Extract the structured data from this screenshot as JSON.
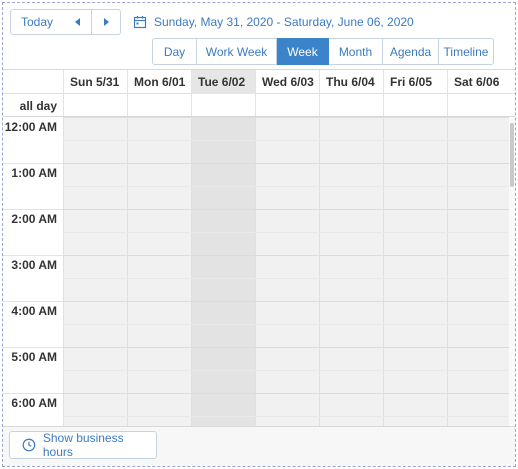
{
  "toolbar": {
    "today_label": "Today",
    "prev_icon": "chevron-left-icon",
    "next_icon": "chevron-right-icon",
    "date_range": "Sunday, May 31, 2020 - Saturday, June 06, 2020",
    "calendar_icon": "calendar-icon"
  },
  "views": [
    {
      "label": "Day",
      "active": false
    },
    {
      "label": "Work Week",
      "active": false
    },
    {
      "label": "Week",
      "active": true
    },
    {
      "label": "Month",
      "active": false
    },
    {
      "label": "Agenda",
      "active": false
    },
    {
      "label": "Timeline",
      "active": false
    }
  ],
  "days": [
    {
      "label": "Sun 5/31",
      "today": false
    },
    {
      "label": "Mon 6/01",
      "today": false
    },
    {
      "label": "Tue 6/02",
      "today": true
    },
    {
      "label": "Wed 6/03",
      "today": false
    },
    {
      "label": "Thu 6/04",
      "today": false
    },
    {
      "label": "Fri 6/05",
      "today": false
    },
    {
      "label": "Sat 6/06",
      "today": false
    }
  ],
  "all_day_label": "all day",
  "times": [
    "12:00 AM",
    "1:00 AM",
    "2:00 AM",
    "3:00 AM",
    "4:00 AM",
    "5:00 AM",
    "6:00 AM"
  ],
  "footer": {
    "business_hours_label": "Show business hours",
    "clock_icon": "clock-icon"
  },
  "colors": {
    "accent": "#3b84c9",
    "link": "#3b7bc1",
    "today_column": "#e3e3e3"
  }
}
